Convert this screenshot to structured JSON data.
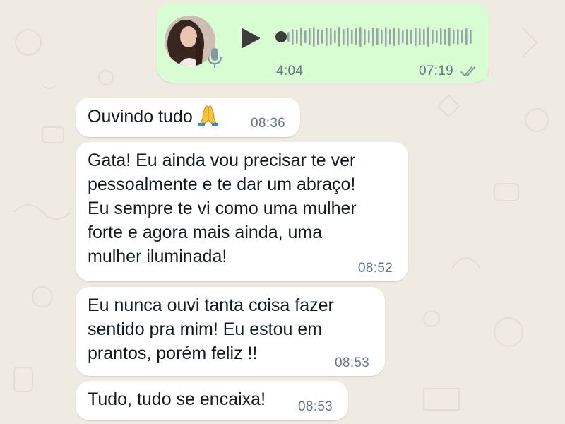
{
  "voice_note": {
    "duration": "4:04",
    "time": "07:19",
    "icons": {
      "avatar": "contact-photo",
      "mic": "microphone-icon",
      "play": "play-icon",
      "status": "double-check-icon"
    }
  },
  "messages": [
    {
      "text": "Ouvindo tudo",
      "emoji": "folded-hands-emoji",
      "time": "08:36"
    },
    {
      "text": "Gata! Eu ainda vou precisar te ver\npessoalmente e te dar um abraço!\nEu sempre te vi como uma mulher\nforte e agora mais ainda, uma\nmulher iluminada!",
      "time": "08:52"
    },
    {
      "text": "Eu nunca ouvi tanta coisa fazer\nsentido pra mim! Eu estou em\nprantos, porém feliz !!",
      "time": "08:53"
    },
    {
      "text": "Tudo, tudo se encaixa!",
      "time": "08:53"
    }
  ],
  "colors": {
    "background": "#efeae2",
    "outgoing_bubble": "#d9fdd3",
    "incoming_bubble": "#ffffff",
    "meta_text": "#667781",
    "read_ticks": "#8696a0"
  }
}
